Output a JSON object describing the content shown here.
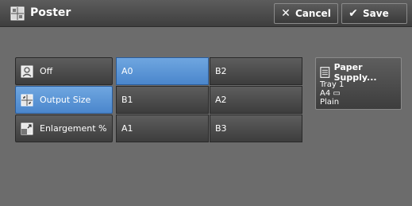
{
  "header": {
    "title": "Poster",
    "title_icon": "poster-icon",
    "cancel_label": "Cancel",
    "save_label": "Save"
  },
  "options": [
    {
      "label": "Off",
      "icon": "off-icon",
      "selected": false
    },
    {
      "label": "Output Size",
      "icon": "output-size-icon",
      "selected": true
    },
    {
      "label": "Enlargement %",
      "icon": "enlargement-icon",
      "selected": false
    }
  ],
  "sizes": [
    {
      "label": "A0",
      "selected": true
    },
    {
      "label": "B2",
      "selected": false
    },
    {
      "label": "B1",
      "selected": false
    },
    {
      "label": "A2",
      "selected": false
    },
    {
      "label": "A1",
      "selected": false
    },
    {
      "label": "B3",
      "selected": false
    }
  ],
  "paper_supply": {
    "label": "Paper Supply...",
    "tray": "Tray 1",
    "size": "A4 ▭",
    "type": "Plain"
  },
  "colors": {
    "background": "#6c6c6c",
    "selected": "#5b96d6",
    "button": "#4a4a4a"
  }
}
